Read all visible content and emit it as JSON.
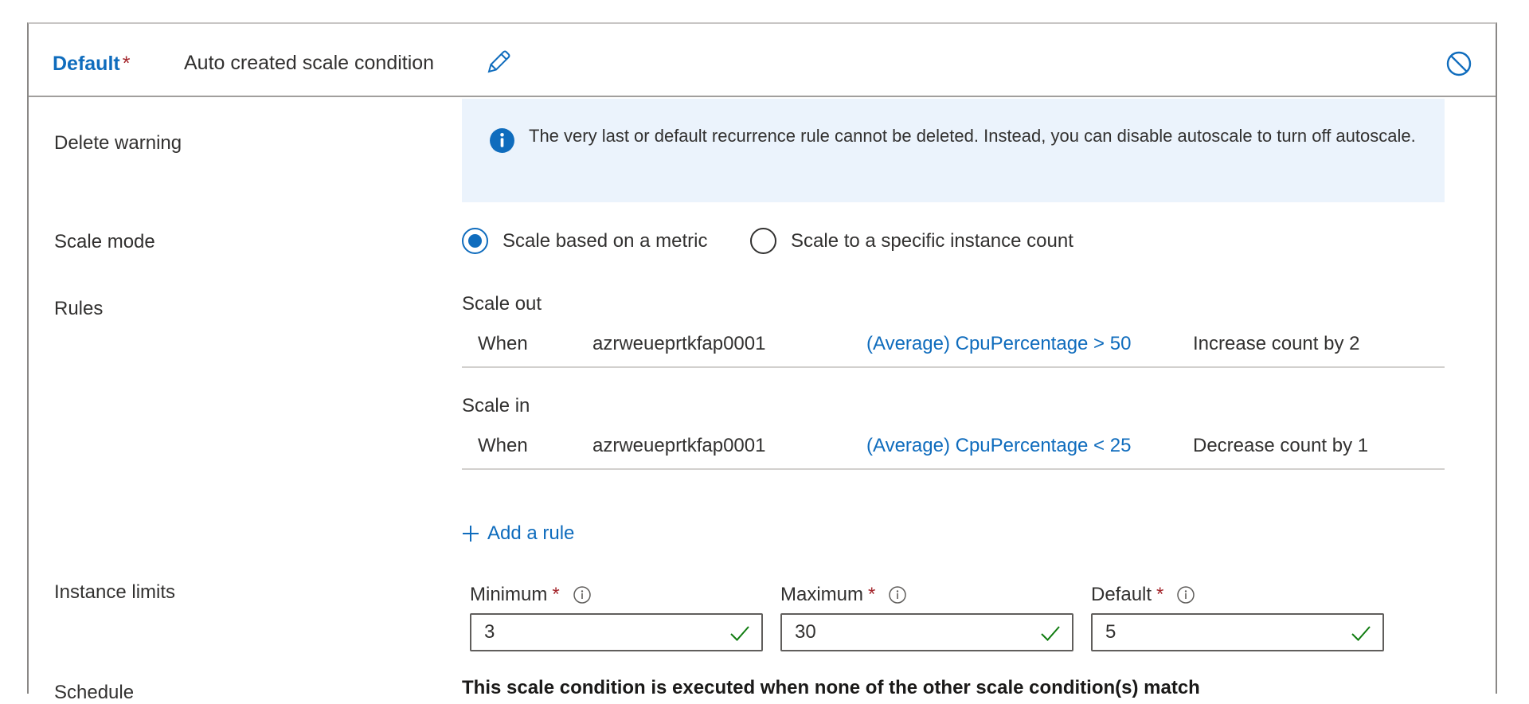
{
  "header": {
    "condition_title": "Default",
    "required_mark": "*",
    "condition_name": "Auto created scale condition",
    "edit_icon": "pencil-icon",
    "disable_icon": "disable-circle-icon"
  },
  "delete_warning": {
    "label": "Delete warning",
    "message": "The very last or default recurrence rule cannot be deleted. Instead, you can disable autoscale to turn off autoscale.",
    "icon": "info-icon"
  },
  "scale_mode": {
    "label": "Scale mode",
    "options": [
      {
        "label": "Scale based on a metric",
        "checked": true
      },
      {
        "label": "Scale to a specific instance count",
        "checked": false
      }
    ]
  },
  "rules": {
    "label": "Rules",
    "scale_out": {
      "title": "Scale out",
      "when": "When",
      "resource": "azrweueprtkfap0001",
      "metric": "(Average) CpuPercentage > 50",
      "action": "Increase count by 2"
    },
    "scale_in": {
      "title": "Scale in",
      "when": "When",
      "resource": "azrweueprtkfap0001",
      "metric": "(Average) CpuPercentage < 25",
      "action": "Decrease count by 1"
    },
    "add_rule": "Add a rule",
    "add_icon": "plus-icon"
  },
  "instance_limits": {
    "label": "Instance limits",
    "minimum": {
      "label": "Minimum",
      "value": "3"
    },
    "maximum": {
      "label": "Maximum",
      "value": "30"
    },
    "default": {
      "label": "Default",
      "value": "5"
    }
  },
  "schedule": {
    "label": "Schedule",
    "text": "This scale condition is executed when none of the other scale condition(s) match"
  },
  "colors": {
    "accent": "#0f6cbd",
    "required": "#a4262c",
    "success": "#107c10",
    "info_bg": "#ebf3fc"
  }
}
